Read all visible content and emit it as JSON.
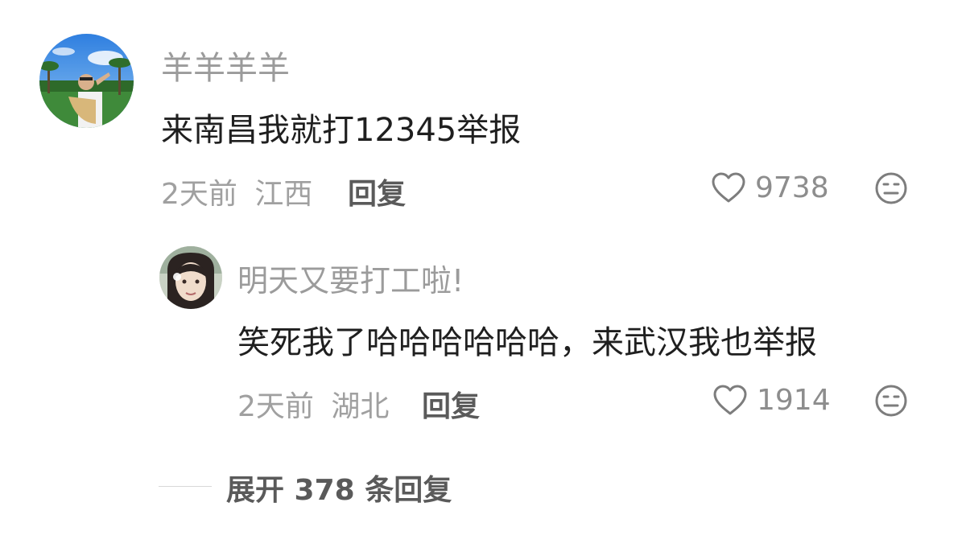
{
  "comments": [
    {
      "username": "羊羊羊羊",
      "text": "来南昌我就打12345举报",
      "time": "2天前",
      "location": "江西",
      "reply_label": "回复",
      "likes": "9738"
    }
  ],
  "replies": [
    {
      "username": "明天又要打工啦!",
      "text": "笑死我了哈哈哈哈哈哈，来武汉我也举报",
      "time": "2天前",
      "location": "湖北",
      "reply_label": "回复",
      "likes": "1914"
    }
  ],
  "expand": {
    "label": "展开 378 条回复"
  },
  "colors": {
    "username": "#9b9b9b",
    "content": "#1f1f1f",
    "meta": "#a0a0a0",
    "action": "#5a5a5a"
  },
  "icons": {
    "like": "heart-outline-icon",
    "dislike": "meh-face-icon"
  }
}
